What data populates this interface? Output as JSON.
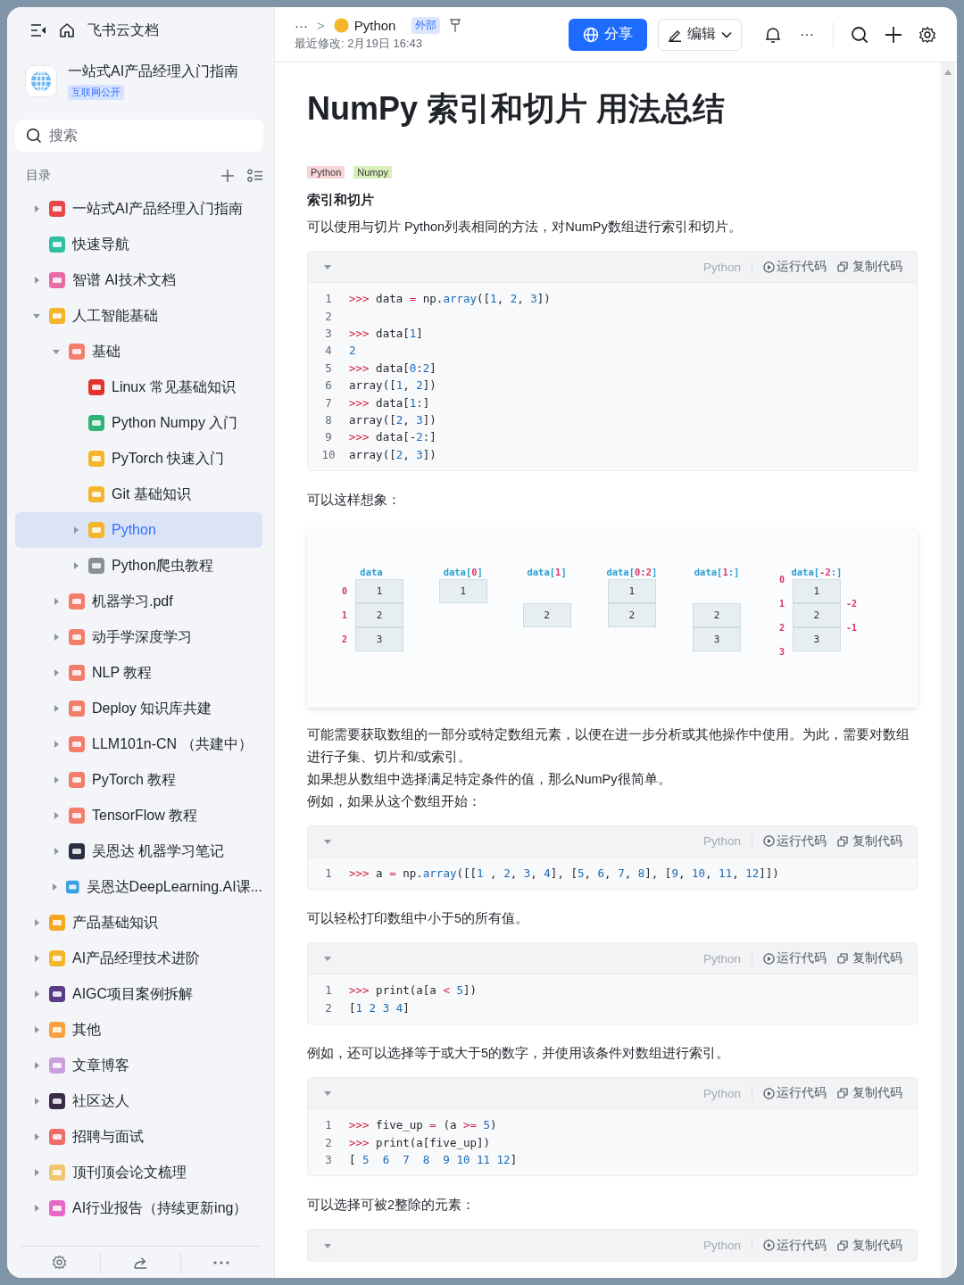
{
  "sidebar": {
    "app_title": "飞书云文档",
    "workspace": {
      "title": "一站式AI产品经理入门指南",
      "badge": "互联网公开"
    },
    "search": {
      "placeholder": "搜索"
    },
    "toc_label": "目录",
    "tree": [
      {
        "label": "一站式AI产品经理入门指南",
        "kind": "branch",
        "expanded": false,
        "selected": false,
        "color": "#e8474a"
      },
      {
        "label": "快速导航",
        "kind": "leaf",
        "selected": false,
        "color": "#2fbfa5"
      },
      {
        "label": "智谱 AI技术文档",
        "kind": "branch",
        "expanded": false,
        "selected": false,
        "color": "#e86aa6"
      },
      {
        "label": "人工智能基础",
        "kind": "branch",
        "expanded": true,
        "selected": false,
        "color": "#f5b52a",
        "children": [
          {
            "label": "基础",
            "kind": "branch",
            "expanded": true,
            "selected": false,
            "color": "#f47c6a",
            "children": [
              {
                "label": "Linux 常见基础知识",
                "kind": "leaf",
                "selected": false,
                "color": "#e5322d"
              },
              {
                "label": "Python Numpy 入门",
                "kind": "leaf",
                "selected": false,
                "color": "#2bb673"
              },
              {
                "label": "PyTorch 快速入门",
                "kind": "leaf",
                "selected": false,
                "color": "#f5b52a"
              },
              {
                "label": "Git 基础知识",
                "kind": "leaf",
                "selected": false,
                "color": "#f5b52a"
              },
              {
                "label": "Python",
                "kind": "branch",
                "expanded": false,
                "selected": true,
                "color": "#f5b52a"
              },
              {
                "label": "Python爬虫教程",
                "kind": "branch",
                "expanded": false,
                "selected": false,
                "color": "#8a8f99"
              }
            ]
          },
          {
            "label": "机器学习.pdf",
            "kind": "branch",
            "expanded": false,
            "selected": false,
            "color": "#f47c6a"
          },
          {
            "label": "动手学深度学习",
            "kind": "branch",
            "expanded": false,
            "selected": false,
            "color": "#f47c6a"
          },
          {
            "label": "NLP 教程",
            "kind": "branch",
            "expanded": false,
            "selected": false,
            "color": "#f47c6a"
          },
          {
            "label": "Deploy 知识库共建",
            "kind": "branch",
            "expanded": false,
            "selected": false,
            "color": "#f47c6a"
          },
          {
            "label": "LLM101n-CN （共建中）",
            "kind": "branch",
            "expanded": false,
            "selected": false,
            "color": "#f47c6a"
          },
          {
            "label": "PyTorch 教程",
            "kind": "branch",
            "expanded": false,
            "selected": false,
            "color": "#f47c6a"
          },
          {
            "label": "TensorFlow 教程",
            "kind": "branch",
            "expanded": false,
            "selected": false,
            "color": "#f47c6a"
          },
          {
            "label": "吴恩达 机器学习笔记",
            "kind": "branch",
            "expanded": false,
            "selected": false,
            "color": "#2b2d42"
          },
          {
            "label": "吴恩达DeepLearning.AI课...",
            "kind": "branch",
            "expanded": false,
            "selected": false,
            "color": "#3aa0e0"
          }
        ]
      },
      {
        "label": "产品基础知识",
        "kind": "branch",
        "expanded": false,
        "selected": false,
        "color": "#f5a623"
      },
      {
        "label": "AI产品经理技术进阶",
        "kind": "branch",
        "expanded": false,
        "selected": false,
        "color": "#f5b52a"
      },
      {
        "label": "AIGC项目案例拆解",
        "kind": "branch",
        "expanded": false,
        "selected": false,
        "color": "#5b3a8a"
      },
      {
        "label": "其他",
        "kind": "branch",
        "expanded": false,
        "selected": false,
        "color": "#f7a23e"
      },
      {
        "label": "文章博客",
        "kind": "branch",
        "expanded": false,
        "selected": false,
        "color": "#c9a0dc"
      },
      {
        "label": "社区达人",
        "kind": "branch",
        "expanded": false,
        "selected": false,
        "color": "#3b2a4a"
      },
      {
        "label": "招聘与面试",
        "kind": "branch",
        "expanded": false,
        "selected": false,
        "color": "#f06a6a"
      },
      {
        "label": "顶刊顶会论文梳理",
        "kind": "branch",
        "expanded": false,
        "selected": false,
        "color": "#f2c66d"
      },
      {
        "label": "AI行业报告（持续更新ing）",
        "kind": "branch",
        "expanded": false,
        "selected": false,
        "color": "#e866c8"
      }
    ]
  },
  "topbar": {
    "breadcrumb_more": "···",
    "breadcrumb_sep": ">",
    "page": "Python",
    "badge": "外部",
    "modified": "最近修改: 2月19日 16:43",
    "share": "分享",
    "edit": "编辑",
    "more": "···"
  },
  "doc": {
    "title": "NumPy 索引和切片 用法总结",
    "tags": [
      {
        "label": "Python",
        "color": "#f9d4d6"
      },
      {
        "label": "Numpy",
        "color": "#d7f0b8"
      }
    ],
    "blocks": [
      {
        "kind": "heading",
        "text": "索引和切片"
      },
      {
        "kind": "text",
        "text": "可以使用与切片 Python列表相同的方法，对NumPy数组进行索引和切片。"
      },
      {
        "kind": "code",
        "lang": "Python",
        "run": "运行代码",
        "copy": "复制代码",
        "lines": [
          {
            "no": "1",
            "tokens": [
              {
                "text": ">>> ",
                "kind": "op"
              },
              {
                "text": "data ",
                "kind": "txt"
              },
              {
                "text": "=",
                "kind": "op"
              },
              {
                "text": " np.",
                "kind": "txt"
              },
              {
                "text": "array",
                "kind": "fn"
              },
              {
                "text": "([",
                "kind": "txt"
              },
              {
                "text": "1",
                "kind": "num"
              },
              {
                "text": ", ",
                "kind": "txt"
              },
              {
                "text": "2",
                "kind": "num"
              },
              {
                "text": ", ",
                "kind": "txt"
              },
              {
                "text": "3",
                "kind": "num"
              },
              {
                "text": "])",
                "kind": "txt"
              }
            ]
          },
          {
            "no": "2"
          },
          {
            "no": "3",
            "tokens": [
              {
                "text": ">>> ",
                "kind": "op"
              },
              {
                "text": "data[",
                "kind": "txt"
              },
              {
                "text": "1",
                "kind": "num"
              },
              {
                "text": "]",
                "kind": "txt"
              }
            ]
          },
          {
            "no": "4",
            "tokens": [
              {
                "text": "2",
                "kind": "num"
              }
            ]
          },
          {
            "no": "5",
            "tokens": [
              {
                "text": ">>> ",
                "kind": "op"
              },
              {
                "text": "data[",
                "kind": "txt"
              },
              {
                "text": "0",
                "kind": "num"
              },
              {
                "text": ":",
                "kind": "txt"
              },
              {
                "text": "2",
                "kind": "num"
              },
              {
                "text": "]",
                "kind": "txt"
              }
            ]
          },
          {
            "no": "6",
            "tokens": [
              {
                "text": "array([",
                "kind": "txt"
              },
              {
                "text": "1",
                "kind": "num"
              },
              {
                "text": ", ",
                "kind": "txt"
              },
              {
                "text": "2",
                "kind": "num"
              },
              {
                "text": "])",
                "kind": "txt"
              }
            ]
          },
          {
            "no": "7",
            "tokens": [
              {
                "text": ">>> ",
                "kind": "op"
              },
              {
                "text": "data[",
                "kind": "txt"
              },
              {
                "text": "1",
                "kind": "num"
              },
              {
                "text": ":]",
                "kind": "txt"
              }
            ]
          },
          {
            "no": "8",
            "tokens": [
              {
                "text": "array([",
                "kind": "txt"
              },
              {
                "text": "2",
                "kind": "num"
              },
              {
                "text": ", ",
                "kind": "txt"
              },
              {
                "text": "3",
                "kind": "num"
              },
              {
                "text": "])",
                "kind": "txt"
              }
            ]
          },
          {
            "no": "9",
            "tokens": [
              {
                "text": ">>> ",
                "kind": "op"
              },
              {
                "text": "data[-",
                "kind": "txt"
              },
              {
                "text": "2",
                "kind": "num"
              },
              {
                "text": ":]",
                "kind": "txt"
              }
            ]
          },
          {
            "no": "10",
            "tokens": [
              {
                "text": "array([",
                "kind": "txt"
              },
              {
                "text": "2",
                "kind": "num"
              },
              {
                "text": ", ",
                "kind": "txt"
              },
              {
                "text": "3",
                "kind": "num"
              },
              {
                "text": "])",
                "kind": "txt"
              }
            ]
          }
        ]
      },
      {
        "kind": "text",
        "text": "可以这样想象："
      },
      {
        "kind": "diagram",
        "columns": [
          {
            "label": [
              {
                "text": "data",
                "kind": "name"
              }
            ],
            "left": {
              "kind": "row",
              "items": [
                {
                  "kind": "label",
                  "text": "0"
                },
                {
                  "kind": "label",
                  "text": "1"
                },
                {
                  "kind": "label",
                  "text": "2"
                }
              ]
            },
            "cells": [
              {
                "kind": "cell",
                "value": "1"
              },
              {
                "kind": "cell",
                "value": "2"
              },
              {
                "kind": "cell",
                "value": "3"
              }
            ]
          },
          {
            "label": [
              {
                "text": "data[",
                "kind": "name"
              },
              {
                "text": "0",
                "kind": "index"
              },
              {
                "text": "]",
                "kind": "name"
              }
            ],
            "cells": [
              {
                "kind": "cell",
                "value": "1"
              }
            ]
          },
          {
            "label": [
              {
                "text": "data[",
                "kind": "name"
              },
              {
                "text": "1",
                "kind": "index"
              },
              {
                "text": "]",
                "kind": "name"
              }
            ],
            "cells": [
              {
                "kind": "gap"
              },
              {
                "kind": "cell",
                "value": "2"
              }
            ]
          },
          {
            "label": [
              {
                "text": "data[",
                "kind": "name"
              },
              {
                "text": "0:2",
                "kind": "index"
              },
              {
                "text": "]",
                "kind": "name"
              }
            ],
            "cells": [
              {
                "kind": "cell",
                "value": "1"
              },
              {
                "kind": "cell",
                "value": "2"
              }
            ]
          },
          {
            "label": [
              {
                "text": "data[",
                "kind": "name"
              },
              {
                "text": "1",
                "kind": "index"
              },
              {
                "text": ":]",
                "kind": "name"
              }
            ],
            "cells": [
              {
                "kind": "gap"
              },
              {
                "kind": "cell",
                "value": "2"
              },
              {
                "kind": "cell",
                "value": "3"
              }
            ]
          },
          {
            "label": [
              {
                "text": "data[",
                "kind": "name"
              },
              {
                "text": "-2",
                "kind": "index"
              },
              {
                "text": ":]",
                "kind": "name"
              }
            ],
            "left": {
              "kind": "edge",
              "items": [
                {
                  "kind": "label",
                  "text": "0"
                },
                {
                  "kind": "label",
                  "text": "1"
                },
                {
                  "kind": "label",
                  "text": "2"
                },
                {
                  "kind": "label",
                  "text": "3"
                }
              ]
            },
            "right": {
              "kind": "edge",
              "items": [
                {
                  "kind": "gap"
                },
                {
                  "kind": "label",
                  "text": "-2"
                },
                {
                  "kind": "label",
                  "text": "-1"
                }
              ]
            },
            "cells": [
              {
                "kind": "cell",
                "value": "1"
              },
              {
                "kind": "cell",
                "value": "2"
              },
              {
                "kind": "cell",
                "value": "3"
              }
            ]
          }
        ]
      },
      {
        "kind": "text",
        "text": "可能需要获取数组的一部分或特定数组元素，以便在进一步分析或其他操作中使用。为此，需要对数组进行子集、切片和/或索引。"
      },
      {
        "kind": "text",
        "text": "如果想从数组中选择满足特定条件的值，那么NumPy很简单。"
      },
      {
        "kind": "text",
        "text": "例如，如果从这个数组开始："
      },
      {
        "kind": "code",
        "lang": "Python",
        "run": "运行代码",
        "copy": "复制代码",
        "lines": [
          {
            "no": "1",
            "tokens": [
              {
                "text": ">>> ",
                "kind": "op"
              },
              {
                "text": "a ",
                "kind": "txt"
              },
              {
                "text": "=",
                "kind": "op"
              },
              {
                "text": " np.",
                "kind": "txt"
              },
              {
                "text": "array",
                "kind": "fn"
              },
              {
                "text": "([[",
                "kind": "txt"
              },
              {
                "text": "1",
                "kind": "num"
              },
              {
                "text": " , ",
                "kind": "txt"
              },
              {
                "text": "2",
                "kind": "num"
              },
              {
                "text": ", ",
                "kind": "txt"
              },
              {
                "text": "3",
                "kind": "num"
              },
              {
                "text": ", ",
                "kind": "txt"
              },
              {
                "text": "4",
                "kind": "num"
              },
              {
                "text": "], [",
                "kind": "txt"
              },
              {
                "text": "5",
                "kind": "num"
              },
              {
                "text": ", ",
                "kind": "txt"
              },
              {
                "text": "6",
                "kind": "num"
              },
              {
                "text": ", ",
                "kind": "txt"
              },
              {
                "text": "7",
                "kind": "num"
              },
              {
                "text": ", ",
                "kind": "txt"
              },
              {
                "text": "8",
                "kind": "num"
              },
              {
                "text": "], [",
                "kind": "txt"
              },
              {
                "text": "9",
                "kind": "num"
              },
              {
                "text": ", ",
                "kind": "txt"
              },
              {
                "text": "10",
                "kind": "num"
              },
              {
                "text": ", ",
                "kind": "txt"
              },
              {
                "text": "11",
                "kind": "num"
              },
              {
                "text": ", ",
                "kind": "txt"
              },
              {
                "text": "12",
                "kind": "num"
              },
              {
                "text": "]])",
                "kind": "txt"
              }
            ]
          }
        ]
      },
      {
        "kind": "text",
        "text": "可以轻松打印数组中小于5的所有值。"
      },
      {
        "kind": "code",
        "lang": "Python",
        "run": "运行代码",
        "copy": "复制代码",
        "lines": [
          {
            "no": "1",
            "tokens": [
              {
                "text": ">>> ",
                "kind": "op"
              },
              {
                "text": "print(a[a ",
                "kind": "txt"
              },
              {
                "text": "<",
                "kind": "op"
              },
              {
                "text": " 5",
                "kind": "num"
              },
              {
                "text": "])",
                "kind": "txt"
              }
            ]
          },
          {
            "no": "2",
            "tokens": [
              {
                "text": "[",
                "kind": "txt"
              },
              {
                "text": "1 2 3 4",
                "kind": "num"
              },
              {
                "text": "]",
                "kind": "txt"
              }
            ]
          }
        ]
      },
      {
        "kind": "text",
        "text": "例如，还可以选择等于或大于5的数字，并使用该条件对数组进行索引。"
      },
      {
        "kind": "code",
        "lang": "Python",
        "run": "运行代码",
        "copy": "复制代码",
        "lines": [
          {
            "no": "1",
            "tokens": [
              {
                "text": ">>> ",
                "kind": "op"
              },
              {
                "text": "five_up ",
                "kind": "txt"
              },
              {
                "text": "=",
                "kind": "op"
              },
              {
                "text": " (a ",
                "kind": "txt"
              },
              {
                "text": ">=",
                "kind": "op"
              },
              {
                "text": " 5",
                "kind": "num"
              },
              {
                "text": ")",
                "kind": "txt"
              }
            ]
          },
          {
            "no": "2",
            "tokens": [
              {
                "text": ">>> ",
                "kind": "op"
              },
              {
                "text": "print(a[five_up])",
                "kind": "txt"
              }
            ]
          },
          {
            "no": "3",
            "tokens": [
              {
                "text": "[ ",
                "kind": "txt"
              },
              {
                "text": "5  6  7  8  9 10 11 12",
                "kind": "num"
              },
              {
                "text": "]",
                "kind": "txt"
              }
            ]
          }
        ]
      },
      {
        "kind": "text",
        "text": "可以选择可被2整除的元素："
      },
      {
        "kind": "code",
        "lang": "Python",
        "run": "运行代码",
        "copy": "复制代码"
      }
    ]
  }
}
